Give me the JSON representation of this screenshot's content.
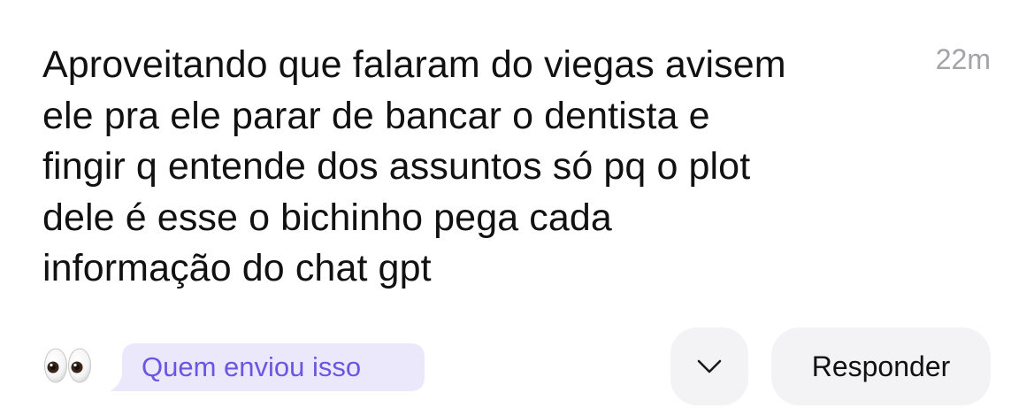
{
  "message": {
    "lines": [
      "Aproveitando que falaram do viegas avisem",
      "ele pra ele parar de bancar o dentista e",
      "fingir q entende dos assuntos só pq o plot",
      "dele é esse o bichinho pega cada",
      "informação do chat gpt"
    ],
    "timestamp": "22m"
  },
  "footer": {
    "reaction_icon": "eyes-emoji-icon",
    "sender_tag_label": "Quem enviou isso",
    "expand_icon": "chevron-down-icon",
    "reply_label": "Responder"
  },
  "colors": {
    "text": "#111111",
    "timestamp": "#a3a3a8",
    "tag_background": "#ece8fc",
    "tag_text": "#6c55e0",
    "button_background": "#f3f3f5"
  }
}
